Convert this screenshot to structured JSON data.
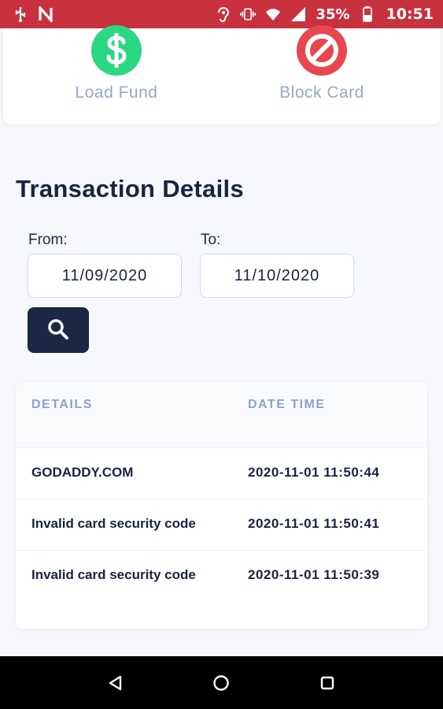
{
  "status_bar": {
    "battery": "35%",
    "time": "10:51",
    "icons": [
      "usb-icon",
      "n-notification-icon",
      "hearing-icon",
      "vibrate-icon",
      "wifi-icon",
      "signal-icon",
      "battery-icon"
    ]
  },
  "actions": {
    "load_fund": {
      "label": "Load Fund",
      "icon": "dollar-icon",
      "color": "#2bd882"
    },
    "block_card": {
      "label": "Block Card",
      "icon": "block-icon",
      "color": "#e8474f"
    }
  },
  "transactions": {
    "title": "Transaction Details",
    "from_label": "From:",
    "to_label": "To:",
    "from_value": "11/09/2020",
    "to_value": "11/10/2020",
    "search_icon": "search-icon",
    "columns": {
      "details": "DETAILS",
      "date_time": "DATE TIME"
    },
    "rows": [
      {
        "details": "GODADDY.COM",
        "date_time": "2020-11-01 11:50:44"
      },
      {
        "details": "Invalid card security code",
        "date_time": "2020-11-01 11:50:41"
      },
      {
        "details": "Invalid card security code",
        "date_time": "2020-11-01 11:50:39"
      }
    ]
  },
  "nav_bar": {
    "icons": [
      "back-icon",
      "home-icon",
      "recents-icon"
    ]
  },
  "colors": {
    "status_bar": "#c8323f",
    "primary_dark": "#1b2743",
    "muted_label": "#9aa8c6"
  }
}
